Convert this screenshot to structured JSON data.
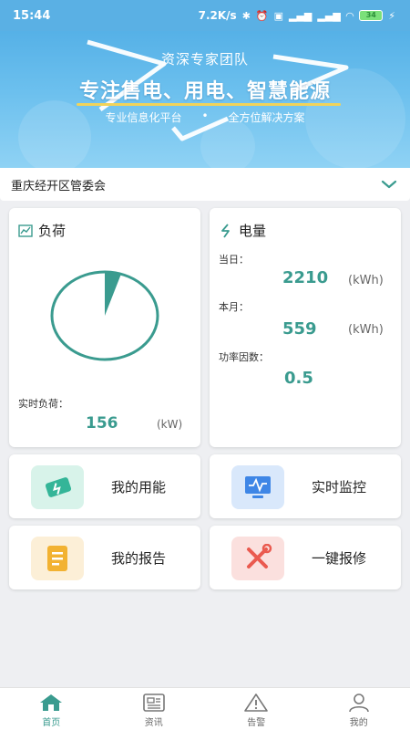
{
  "status_bar": {
    "time": "15:44",
    "speed": "7.2K/s",
    "battery": "34"
  },
  "banner": {
    "team": "资深专家团队",
    "slogan": "专注售电、用电、智慧能源",
    "sub_left": "专业信息化平台",
    "sub_dot": "•",
    "sub_right": "全方位解决方案"
  },
  "location": {
    "selected": "重庆经开区管委会"
  },
  "load_card": {
    "title": "负荷",
    "realtime_label": "实时负荷：",
    "realtime_value": "156",
    "unit": "(kW)",
    "gauge_fill_fraction": 0.05
  },
  "elec_card": {
    "title": "电量",
    "day_label": "当日：",
    "day_value": "2210",
    "day_unit": "(kWh)",
    "month_label": "本月：",
    "month_value": "559",
    "month_unit": "(kWh)",
    "pf_label": "功率因数：",
    "pf_value": "0.5"
  },
  "tiles": {
    "energy": "我的用能",
    "monitor": "实时监控",
    "report": "我的报告",
    "repair": "一键报修"
  },
  "nav": {
    "home": "首页",
    "news": "资讯",
    "alarm": "告警",
    "mine": "我的"
  },
  "colors": {
    "accent": "#3a9b8f",
    "banner": "#5ab0e4"
  }
}
